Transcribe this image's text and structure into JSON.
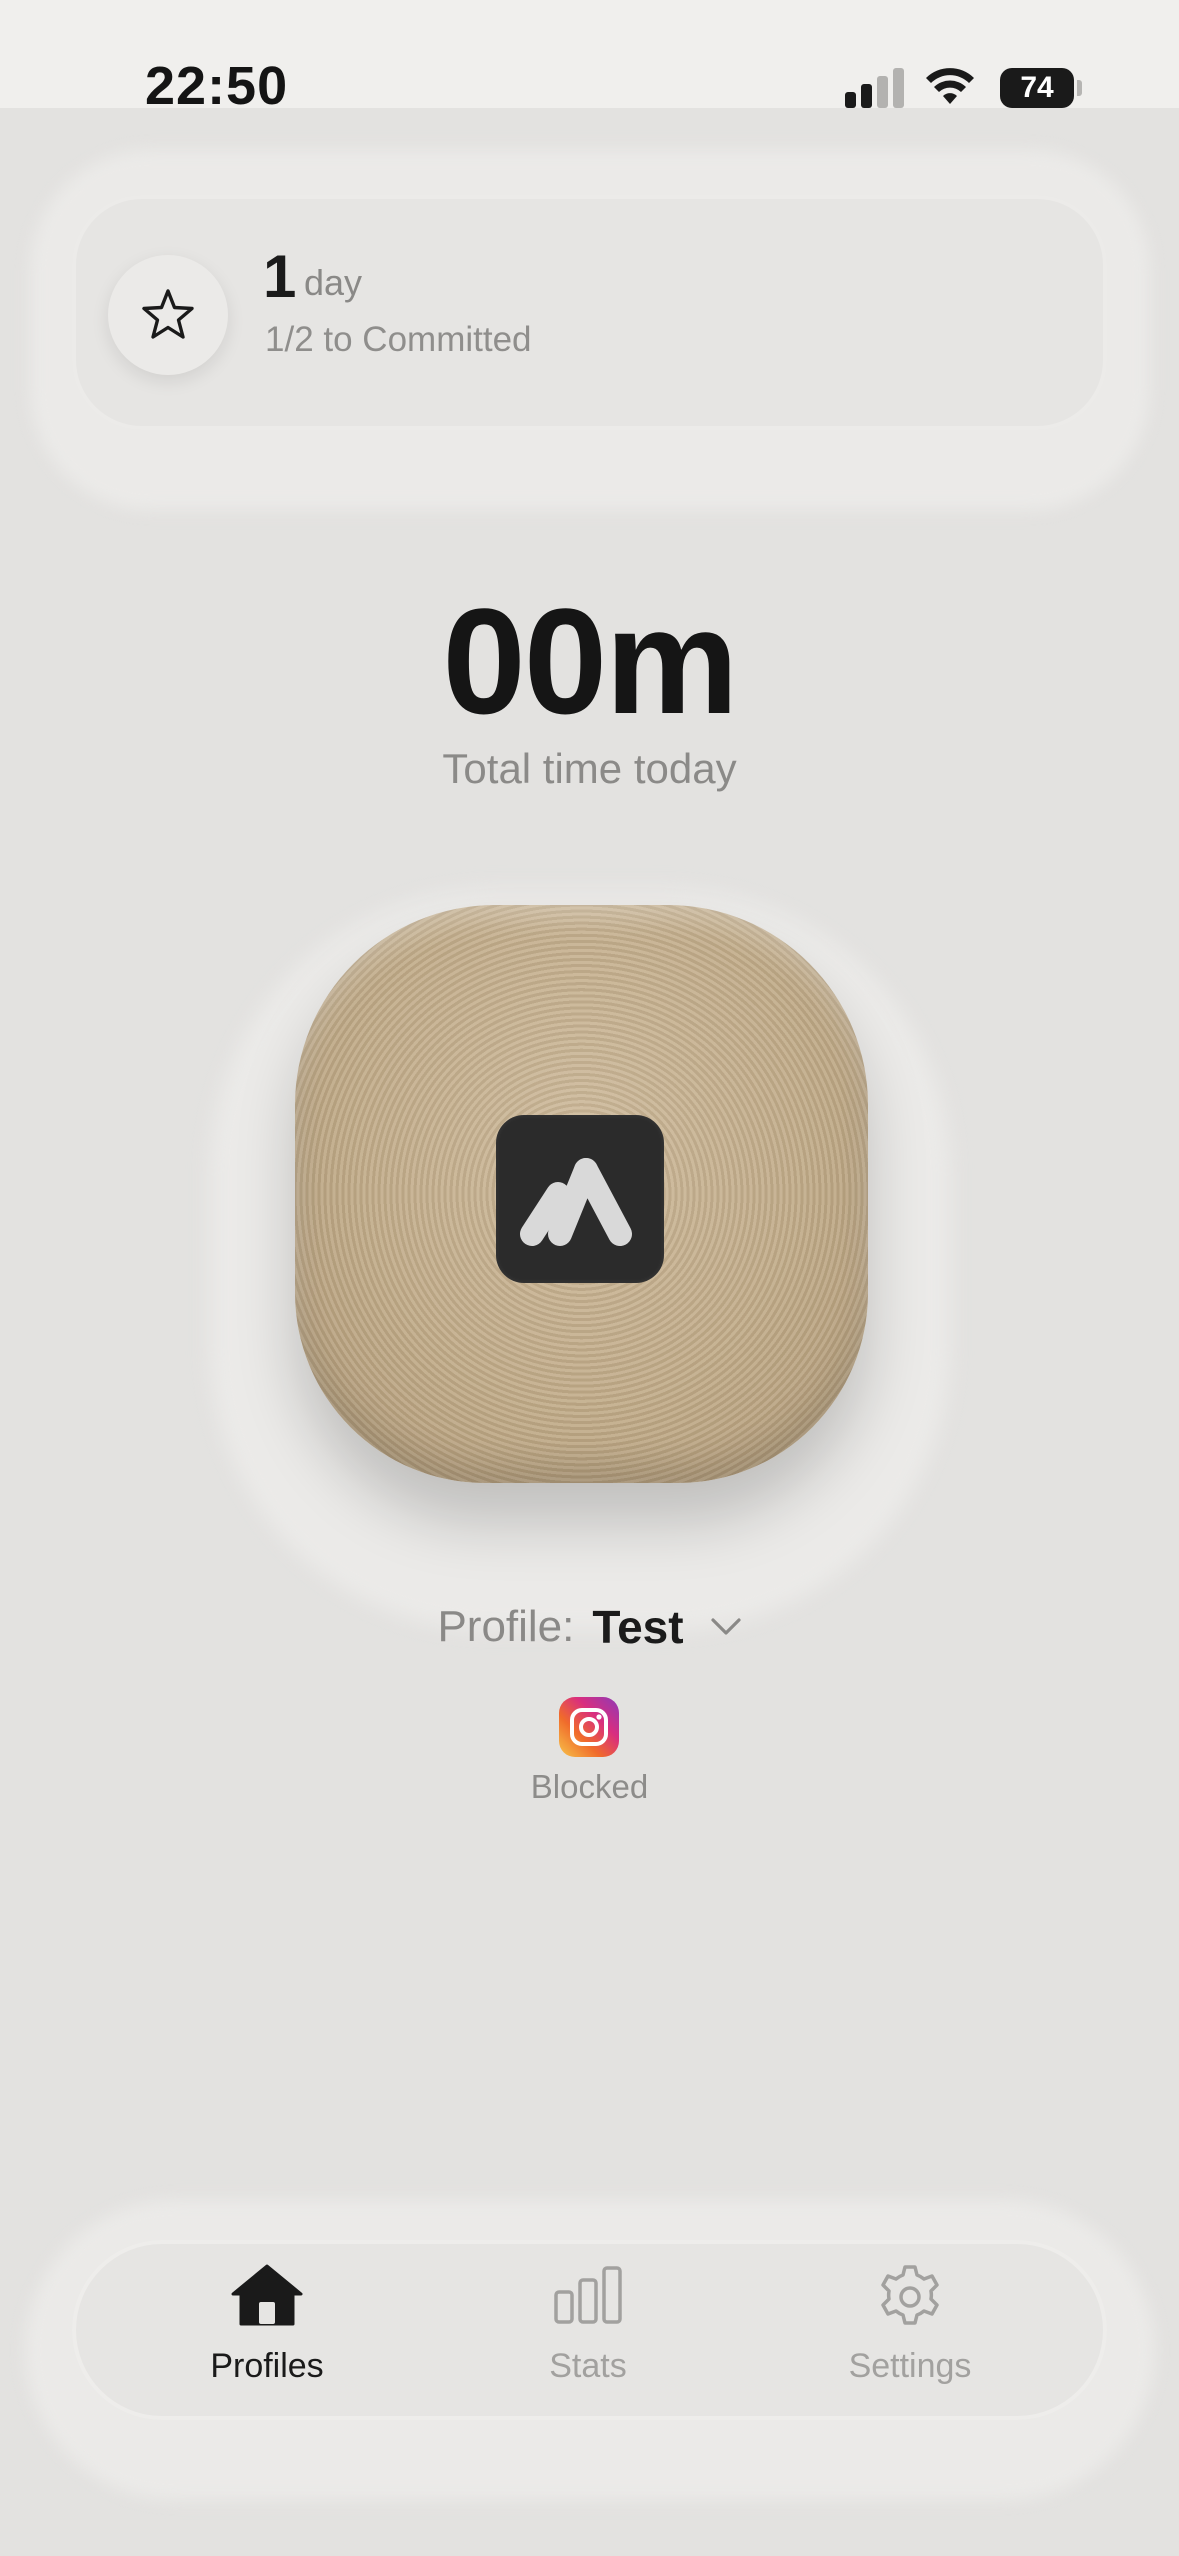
{
  "status_bar": {
    "time": "22:50",
    "battery": "74"
  },
  "streak": {
    "icon": "star-icon",
    "count": "1",
    "unit": "day",
    "progress_text": "1/2 to Committed"
  },
  "summary": {
    "total_time": "00m",
    "total_label": "Total time today"
  },
  "device": {
    "icon": "brick-logo-icon"
  },
  "profile": {
    "label": "Profile:",
    "value": "Test"
  },
  "blocked_apps": {
    "items": [
      {
        "icon": "instagram-icon"
      }
    ],
    "status_label": "Blocked"
  },
  "tab_bar": {
    "tabs": [
      {
        "label": "Profiles",
        "icon": "house-icon",
        "active": true
      },
      {
        "label": "Stats",
        "icon": "bar-chart-icon",
        "active": false
      },
      {
        "label": "Settings",
        "icon": "gear-icon",
        "active": false
      }
    ]
  },
  "colors": {
    "background": "#e3e2e0",
    "device": "#c1ab88",
    "active_tab": "#1a1a1a",
    "inactive_tab": "#a2a19f"
  }
}
